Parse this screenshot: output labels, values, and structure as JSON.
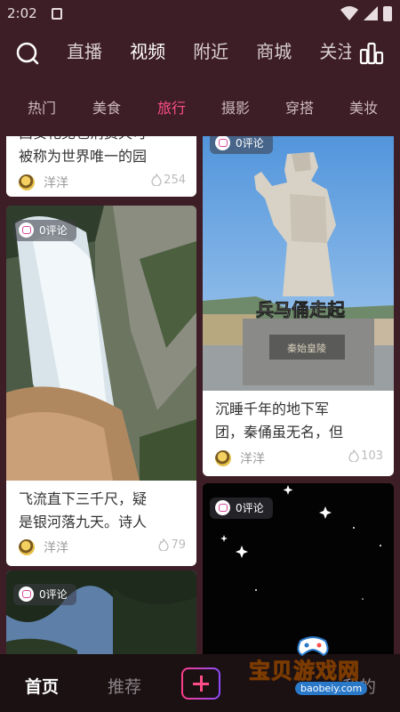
{
  "status_bar": {
    "time": "2:02"
  },
  "top_tabs": [
    "直播",
    "视频",
    "附近",
    "商城",
    "关注"
  ],
  "sub_categories": [
    "热门",
    "美食",
    "旅行",
    "摄影",
    "穿搭",
    "美妆"
  ],
  "cards": [
    {
      "title": "西安花见也消费天可被称为世界唯一的园",
      "title_line1": "西安花见也消费天可",
      "title_line2": "被称为世界唯一的园",
      "author": "洋洋",
      "likes": "254"
    },
    {
      "comments": "0评论",
      "title_line1": "飞流直下三千尺，疑",
      "title_line2": "是银河落九天。诗人",
      "author": "洋洋",
      "likes": "79"
    },
    {
      "comments": "0评论"
    },
    {
      "comments": "0评论",
      "image_caption": "兵马俑走起",
      "image_sign": "秦始皇陵",
      "title_line1": "沉睡千年的地下军",
      "title_line2": "团，秦俑虽无名，但",
      "author": "洋洋",
      "likes": "103"
    },
    {
      "comments": "0评论"
    }
  ],
  "bottom_nav": {
    "home": "首页",
    "recommend": "推荐",
    "mine": "我的"
  },
  "watermark": {
    "text": "宝贝游戏网",
    "domain": "baobeiy.com"
  },
  "colors": {
    "background": "#3d1e26",
    "accent": "#ff4d8a",
    "bottom_bar": "#1b1012"
  }
}
